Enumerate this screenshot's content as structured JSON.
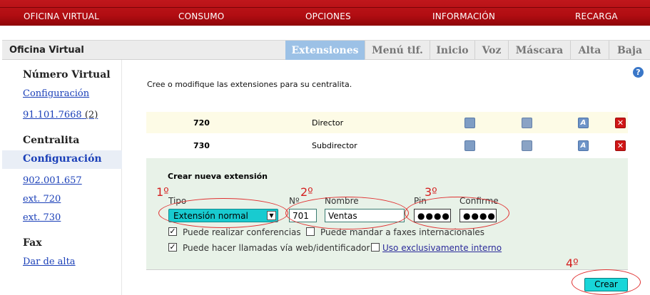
{
  "topnav": [
    "OFICINA VIRTUAL",
    "CONSUMO",
    "OPCIONES",
    "INFORMACIÓN",
    "RECARGA"
  ],
  "header": {
    "title": "Oficina Virtual",
    "tabs": [
      "Extensiones",
      "Menú tlf.",
      "Inicio",
      "Voz",
      "Máscara",
      "Alta",
      "Baja"
    ],
    "active_tab": "Extensiones"
  },
  "sidebar": {
    "sec1": "Número Virtual",
    "sec1_link": "Configuración",
    "number": "91.101.7668",
    "number_count": "(2)",
    "sec2": "Centralita",
    "sec2_selected": "Configuración",
    "links": [
      "902.001.657",
      "ext. 720",
      "ext. 730"
    ],
    "sec3": "Fax",
    "sec3_link": "Dar de alta"
  },
  "intro": "Cree o modifique las extensiones para su centralita.",
  "extensions": [
    {
      "number": "720",
      "name": "Director"
    },
    {
      "number": "730",
      "name": "Subdirector"
    }
  ],
  "icons": {
    "forward": "forward-icon",
    "lock": "lock-icon",
    "voice": "voice-a-icon",
    "delete": "delete-x-icon",
    "help": "help-icon"
  },
  "form": {
    "title": "Crear nueva extensión",
    "tipo_label": "Tipo",
    "tipo_value": "Extensión normal",
    "num_label": "Nº",
    "num_value": "701",
    "nombre_label": "Nombre",
    "nombre_value": "Ventas",
    "pin_label": "Pin",
    "pin_value": "●●●●",
    "confirme_label": "Confirme",
    "confirme_value": "●●●●",
    "cb1_label": "Puede realizar conferencias",
    "cb1_checked": true,
    "cb2_label": "Puede mandar a faxes internacionales",
    "cb2_checked": false,
    "cb3_label": "Puede hacer llamadas vía web/identificador",
    "cb3_checked": true,
    "cb4_label": "Uso exclusivamente interno",
    "cb4_checked": false,
    "submit": "Crear"
  },
  "annotations": [
    "1º",
    "2º",
    "3º",
    "4º"
  ],
  "colors": {
    "nav": "#b10d12",
    "active_tab": "#9cc1e6",
    "form_bg": "#e8f2e8",
    "highlight_row": "#fdfbe6",
    "annotation": "#d42020",
    "button": "#18d6d9"
  }
}
